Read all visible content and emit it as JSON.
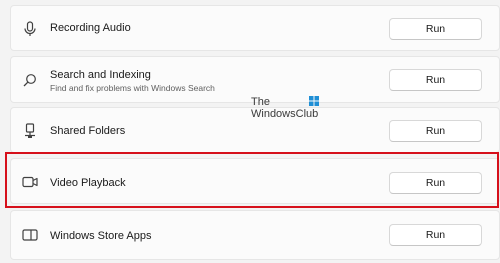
{
  "troubleshooters": [
    {
      "title": "Recording Audio",
      "subtitle": "",
      "icon": "microphone-icon",
      "button_label": "Run"
    },
    {
      "title": "Search and Indexing",
      "subtitle": "Find and fix problems with Windows Search",
      "icon": "search-icon",
      "button_label": "Run"
    },
    {
      "title": "Shared Folders",
      "subtitle": "",
      "icon": "shared-folder-icon",
      "button_label": "Run"
    },
    {
      "title": "Video Playback",
      "subtitle": "",
      "icon": "video-camera-icon",
      "button_label": "Run"
    },
    {
      "title": "Windows Store Apps",
      "subtitle": "",
      "icon": "store-app-icon",
      "button_label": "Run"
    }
  ],
  "watermark": {
    "line1": "The",
    "line2": "WindowsClub"
  },
  "colors": {
    "highlight": "#d6101b",
    "row_bg": "#fbfbfb",
    "page_bg": "#f3f3f3"
  }
}
